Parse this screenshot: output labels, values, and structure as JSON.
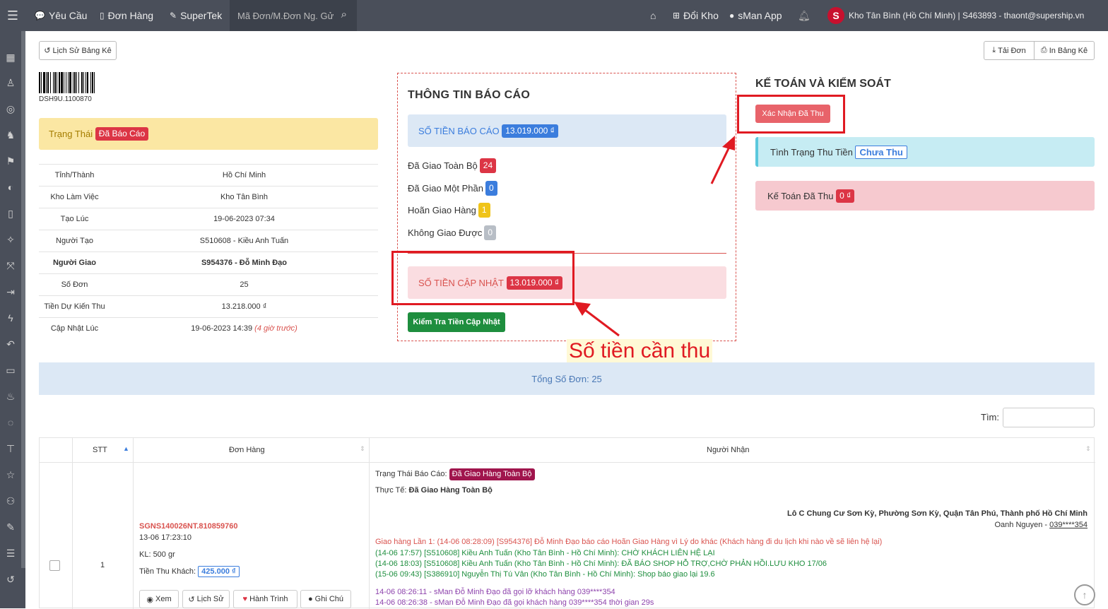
{
  "topnav": {
    "yeu_cau": "Yêu Cầu",
    "don_hang": "Đơn Hàng",
    "supertek": "SuperTek",
    "search_placeholder": "Mã Đơn/M.Đơn Ng. Gử",
    "doi_kho": "Đổi Kho",
    "sman_app": "sMan App",
    "account": "Kho Tân Bình (Hồ Chí Minh) | S463893 - thaont@supership.vn"
  },
  "toolbar": {
    "history_btn": "Lịch Sử Bảng Kê",
    "download_btn": "Tải Đơn",
    "print_btn": "In Bảng Kê"
  },
  "barcode_text": "DSH9U.1100870",
  "status": {
    "label": "Trạng Thái",
    "value": "Đã Báo Cáo"
  },
  "info_rows": [
    {
      "key": "Tỉnh/Thành",
      "value": "Hồ Chí Minh"
    },
    {
      "key": "Kho Làm Việc",
      "value": "Kho Tân Bình"
    },
    {
      "key": "Tạo Lúc",
      "value": "19-06-2023 07:34"
    },
    {
      "key": "Người Tạo",
      "value": "S510608 - Kiều Anh Tuấn"
    },
    {
      "key": "Người Giao",
      "value": "S954376 - Đỗ Minh Đạo"
    },
    {
      "key": "Số Đơn",
      "value": "25"
    },
    {
      "key": "Tiền Dự Kiến Thu",
      "value": "13.218.000 ₫"
    },
    {
      "key": "Cập Nhật Lúc",
      "value": "19-06-2023 14:39",
      "note": "(4 giờ trước)"
    }
  ],
  "report": {
    "title": "THÔNG TIN BÁO CÁO",
    "amount_label": "SỐ TIỀN BÁO CÁO",
    "amount_value": "13.019.000 ₫",
    "stats": [
      {
        "label": "Đã Giao Toàn Bộ",
        "value": "24"
      },
      {
        "label": "Đã Giao Một Phần",
        "value": "0"
      },
      {
        "label": "Hoãn Giao Hàng",
        "value": "1"
      },
      {
        "label": "Không Giao Được",
        "value": "0"
      }
    ],
    "updated_label": "SỐ TIỀN CẬP NHẬT",
    "updated_value": "13.019.000 ₫",
    "check_btn": "Kiểm Tra Tiền Cập Nhật"
  },
  "accounting": {
    "title": "KẾ TOÁN VÀ KIỂM SOÁT",
    "confirm_btn": "Xác Nhận Đã Thu",
    "collect_status_label": "Tình Trạng Thu Tiền",
    "collect_status_value": "Chưa Thu",
    "collected_label": "Kế Toán Đã Thu",
    "collected_value": "0 ₫"
  },
  "annotation": "Số tiền cần thu",
  "summary": "Tổng Số Đơn: 25",
  "find_label": "Tìm:",
  "table": {
    "headers": {
      "stt": "STT",
      "order": "Đơn Hàng",
      "receiver": "Người Nhận"
    },
    "row": {
      "stt": "1",
      "code": "SGNS140026NT.810859760",
      "created": "13-06 17:23:10",
      "weight": "KL: 500 gr",
      "cod_label": "Tiền Thu Khách:",
      "cod_value": "425.000 ₫",
      "btn_view": "Xem",
      "btn_history": "Lịch Sử",
      "btn_journey": "Hành Trình",
      "btn_note": "Ghi Chú",
      "report_status_label": "Trạng Thái Báo Cáo:",
      "report_status_value": "Đã Giao Hàng Toàn Bộ",
      "actual_label": "Thực Tế:",
      "actual_value": "Đã Giao Hàng Toàn Bộ",
      "address": "Lô C Chung Cư Sơn Kỳ, Phường Sơn Kỳ, Quận Tân Phú, Thành phố Hồ Chí Minh",
      "receiver_name": "Oanh Nguyen - ",
      "receiver_phone": "039****354",
      "log_red": "Giao hàng Lần 1: (14-06 08:28:09) [S954376] Đỗ Minh Đạo báo cáo Hoãn Giao Hàng vì Lý do khác (Khách hàng đi du lịch khi nào về sẽ liên hệ lại)",
      "log_green": [
        "(14-06 17:57) [S510608] Kiều Anh Tuấn (Kho Tân Bình - Hồ Chí Minh): CHỜ KHÁCH LIÊN HỆ LẠI",
        "(14-06 18:03) [S510608] Kiều Anh Tuấn (Kho Tân Bình - Hồ Chí Minh): ĐÃ BÁO SHOP HỖ TRỢ,CHỜ PHẢN HỒI.LƯU KHO 17/06",
        "(15-06 09:43) [S386910] Nguyễn Thị Tú Vân (Kho Tân Bình - Hồ Chí Minh): Shop báo giao lại 19.6"
      ],
      "log_purple": [
        "14-06 08:26:11 - sMan Đỗ Minh Đạo đã gọi lỡ khách hàng 039****354",
        "14-06 08:26:38 - sMan Đỗ Minh Đạo đã gọi khách hàng 039****354 thời gian 29s"
      ]
    }
  },
  "colors": {
    "nav_bg": "#4a4f5a",
    "danger": "#dc3545",
    "primary": "#3b7ddd",
    "success": "#1e8e3e",
    "annotation_red": "#e01a22"
  }
}
